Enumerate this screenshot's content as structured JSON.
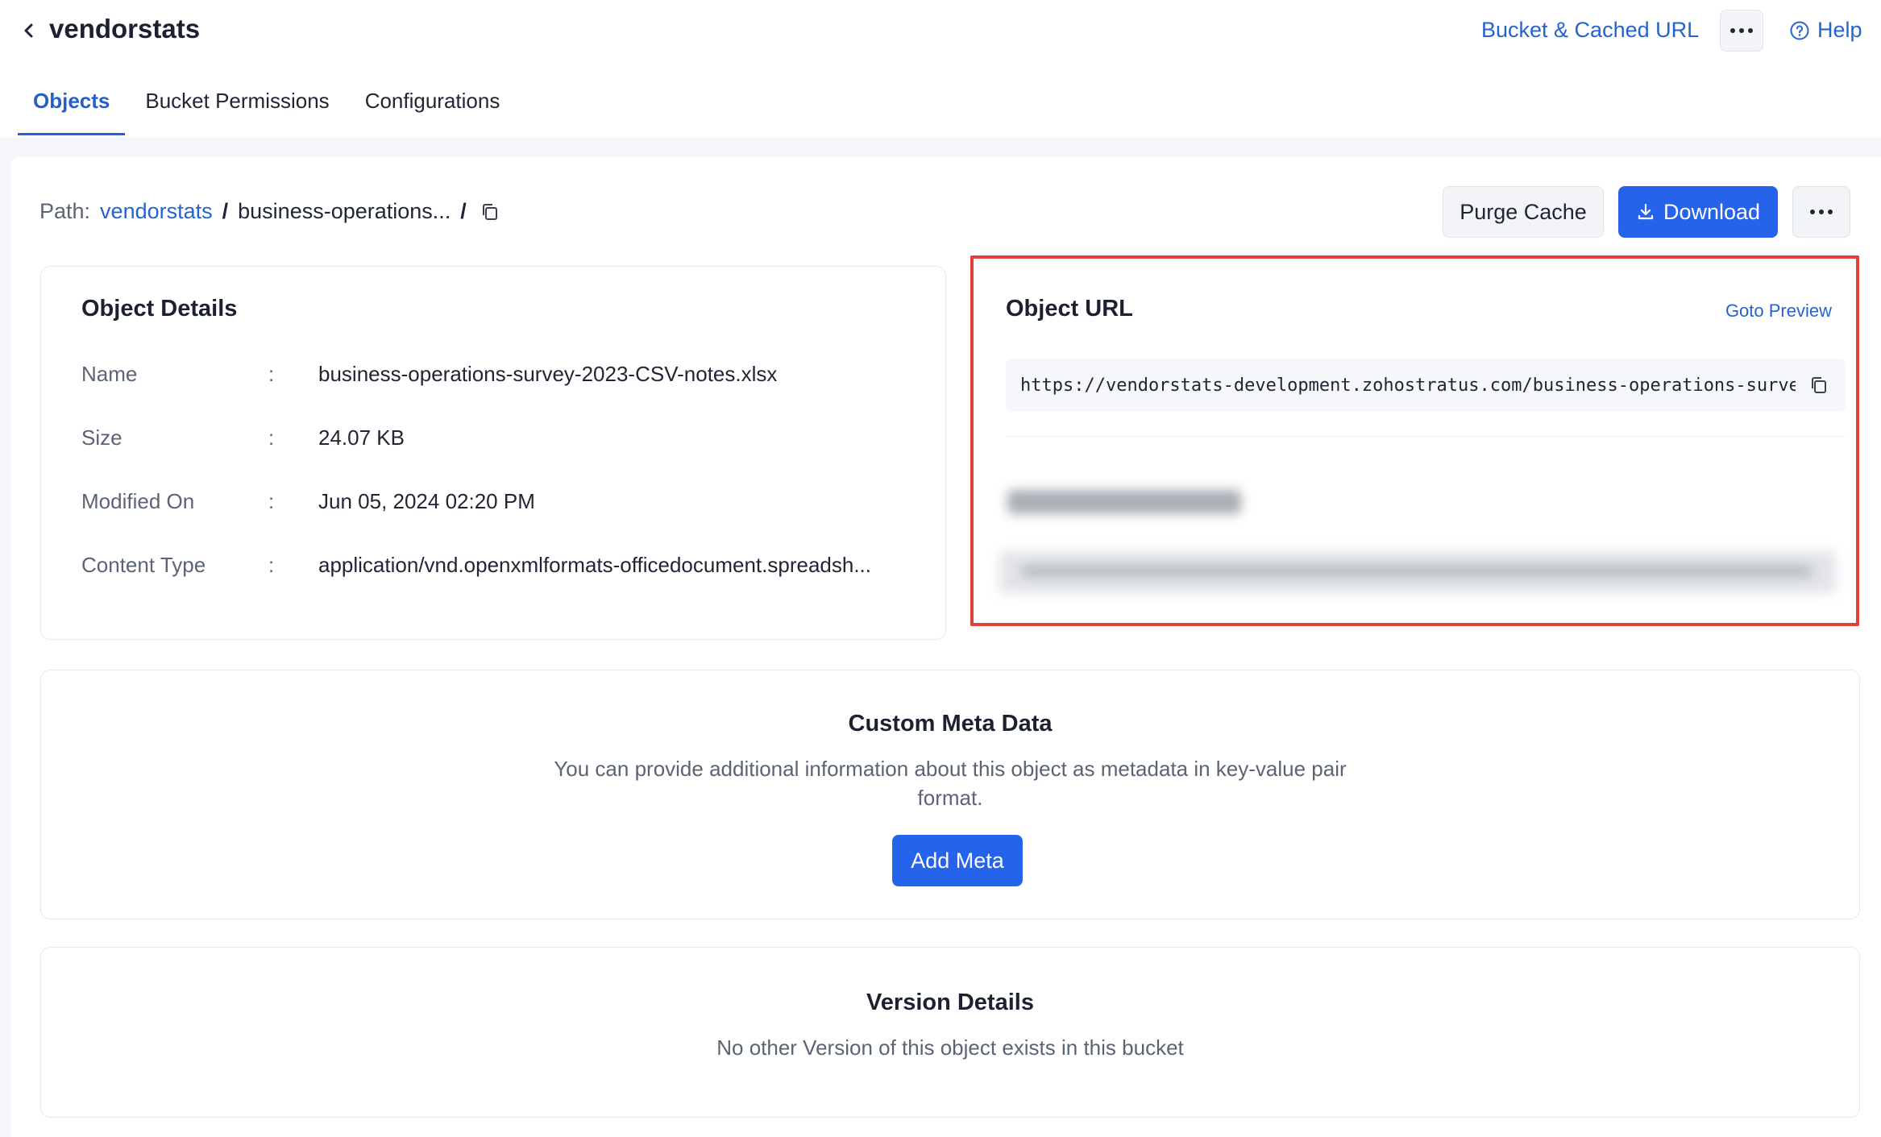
{
  "header": {
    "bucket_name": "vendorstats",
    "cached_url_link": "Bucket & Cached URL",
    "help_label": "Help"
  },
  "tabs": [
    {
      "label": "Objects",
      "active": true
    },
    {
      "label": "Bucket Permissions",
      "active": false
    },
    {
      "label": "Configurations",
      "active": false
    }
  ],
  "path": {
    "label": "Path:",
    "root": "vendorstats",
    "separator": "/",
    "folder": "business-operations..."
  },
  "toolbar": {
    "purge_label": "Purge Cache",
    "download_label": "Download"
  },
  "object_details": {
    "title": "Object Details",
    "separator": ":",
    "rows": [
      {
        "key": "Name",
        "value": "business-operations-survey-2023-CSV-notes.xlsx"
      },
      {
        "key": "Size",
        "value": "24.07 KB"
      },
      {
        "key": "Modified On",
        "value": "Jun 05, 2024 02:20 PM"
      },
      {
        "key": "Content Type",
        "value": "application/vnd.openxmlformats-officedocument.spreadsh..."
      }
    ]
  },
  "object_url": {
    "title": "Object URL",
    "goto_preview": "Goto Preview",
    "url": "https://vendorstats-development.zohostratus.com/business-operations-survey-"
  },
  "custom_meta": {
    "title": "Custom Meta Data",
    "description": "You can provide additional information about this object as metadata in key-value pair format.",
    "add_label": "Add Meta"
  },
  "version_details": {
    "title": "Version Details",
    "description": "No other Version of this object exists in this bucket"
  },
  "colors": {
    "accent": "#2563eb",
    "link": "#2563d0",
    "highlight_border": "#e0413b"
  }
}
